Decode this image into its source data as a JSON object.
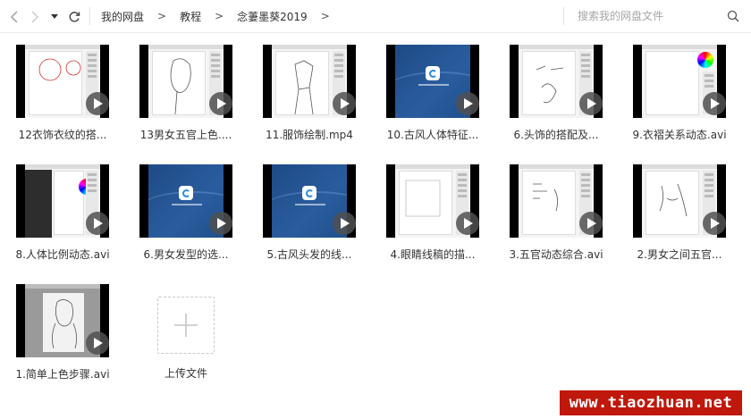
{
  "toolbar": {
    "back_icon": "chevron-left-icon",
    "forward_icon": "chevron-right-icon",
    "history_icon": "caret-down-icon",
    "refresh_icon": "refresh-icon"
  },
  "breadcrumb": {
    "items": [
      "我的网盘",
      "教程",
      "念萋墨葵2019"
    ],
    "separator": ">"
  },
  "search": {
    "placeholder": "搜索我的网盘文件",
    "icon": "search-icon"
  },
  "files": [
    {
      "name": "12衣饰衣纹的搭...",
      "thumb": "sketch-app"
    },
    {
      "name": "13男女五官上色....",
      "thumb": "sketch-app"
    },
    {
      "name": "11.服饰绘制.mp4",
      "thumb": "sketch-app"
    },
    {
      "name": "10.古风人体特征...",
      "thumb": "blue-splash"
    },
    {
      "name": "6.头饰的搭配及...",
      "thumb": "sketch-app"
    },
    {
      "name": "9.衣褶关系动态.avi",
      "thumb": "color-app"
    },
    {
      "name": "8.人体比例动态.avi",
      "thumb": "dark-app"
    },
    {
      "name": "6.男女发型的选...",
      "thumb": "blue-splash"
    },
    {
      "name": "5.古风头发的线...",
      "thumb": "blue-splash"
    },
    {
      "name": "4.眼睛线稿的描...",
      "thumb": "sketch-app"
    },
    {
      "name": "3.五官动态综合.avi",
      "thumb": "sketch-app"
    },
    {
      "name": "2.男女之间五官...",
      "thumb": "sketch-app"
    },
    {
      "name": "1.简单上色步骤.avi",
      "thumb": "gray-app"
    }
  ],
  "upload": {
    "label": "上传文件",
    "icon": "plus-icon"
  },
  "watermark": {
    "text": "www.tiaozhuan.net"
  },
  "colors": {
    "accent_blue": "#2a5d9e",
    "watermark_red": "#c0180c",
    "play_button": "#505050"
  }
}
